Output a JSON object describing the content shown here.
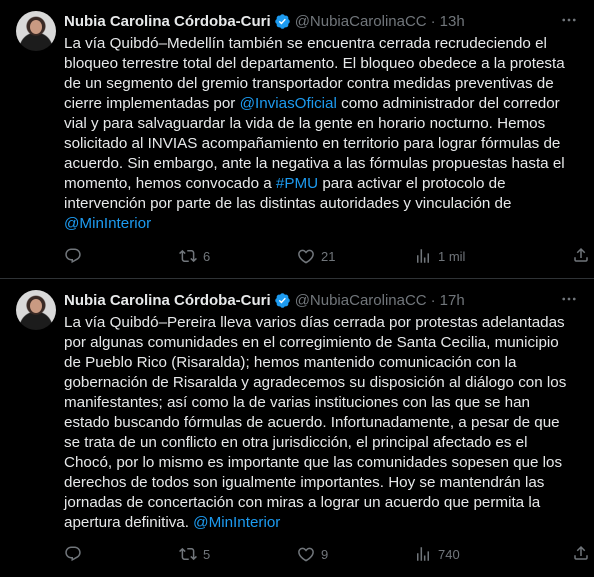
{
  "tweets": [
    {
      "name": "Nubia Carolina Córdoba-Curi",
      "handle": "@NubiaCarolinaCC",
      "dot": "·",
      "time": "13h",
      "text": {
        "p1": "La vía Quibdó–Medellín también se encuentra cerrada recrudeciendo el bloqueo terrestre total del departamento. El bloqueo obedece a la protesta de un segmento del gremio transportador contra medidas preventivas de cierre implementadas por ",
        "mention1": "@InviasOficial",
        "p2": " como administrador del corredor vial y para salvaguardar la vida de la gente en horario nocturno. Hemos solicitado al INVIAS acompañamiento en territorio para lograr fórmulas de acuerdo. Sin embargo, ante la negativa a las fórmulas propuestas hasta el momento, hemos convocado a ",
        "hashtag": "#PMU",
        "p3": " para activar el protocolo de intervención por parte de las distintas autoridades y vinculación de ",
        "mention2": "@MinInterior",
        "p4": ""
      },
      "stats": {
        "replies": "",
        "retweets": "6",
        "likes": "21",
        "views": "1 mil"
      }
    },
    {
      "name": "Nubia Carolina Córdoba-Curi",
      "handle": "@NubiaCarolinaCC",
      "dot": "·",
      "time": "17h",
      "text": {
        "p1": "La vía Quibdó–Pereira lleva varios días cerrada por protestas adelantadas por algunas comunidades en el corregimiento de Santa Cecilia, municipio de Pueblo Rico (Risaralda); hemos mantenido comunicación con la gobernación de Risaralda y agradecemos su disposición al diálogo con los manifestantes; así como la de varias instituciones con las que se han estado buscando fórmulas de acuerdo. Infortunadamente, a pesar de que se trata de un conflicto en otra jurisdicción, el principal afectado es el Chocó, por lo mismo es importante que las comunidades sopesen que los derechos de todos son igualmente importantes. Hoy se mantendrán las jornadas de concertación con miras a lograr un acuerdo que permita la apertura definitiva. ",
        "mention1": "@MinInterior"
      },
      "stats": {
        "replies": "",
        "retweets": "5",
        "likes": "9",
        "views": "740"
      }
    }
  ],
  "colors": {
    "background": "#000000",
    "text": "#e7e9ea",
    "muted": "#71767b",
    "link": "#1d9bf0",
    "verified": "#1d9bf0"
  },
  "icons": [
    "verified-badge-icon",
    "more-icon",
    "reply-icon",
    "retweet-icon",
    "like-icon",
    "views-icon",
    "share-icon"
  ]
}
